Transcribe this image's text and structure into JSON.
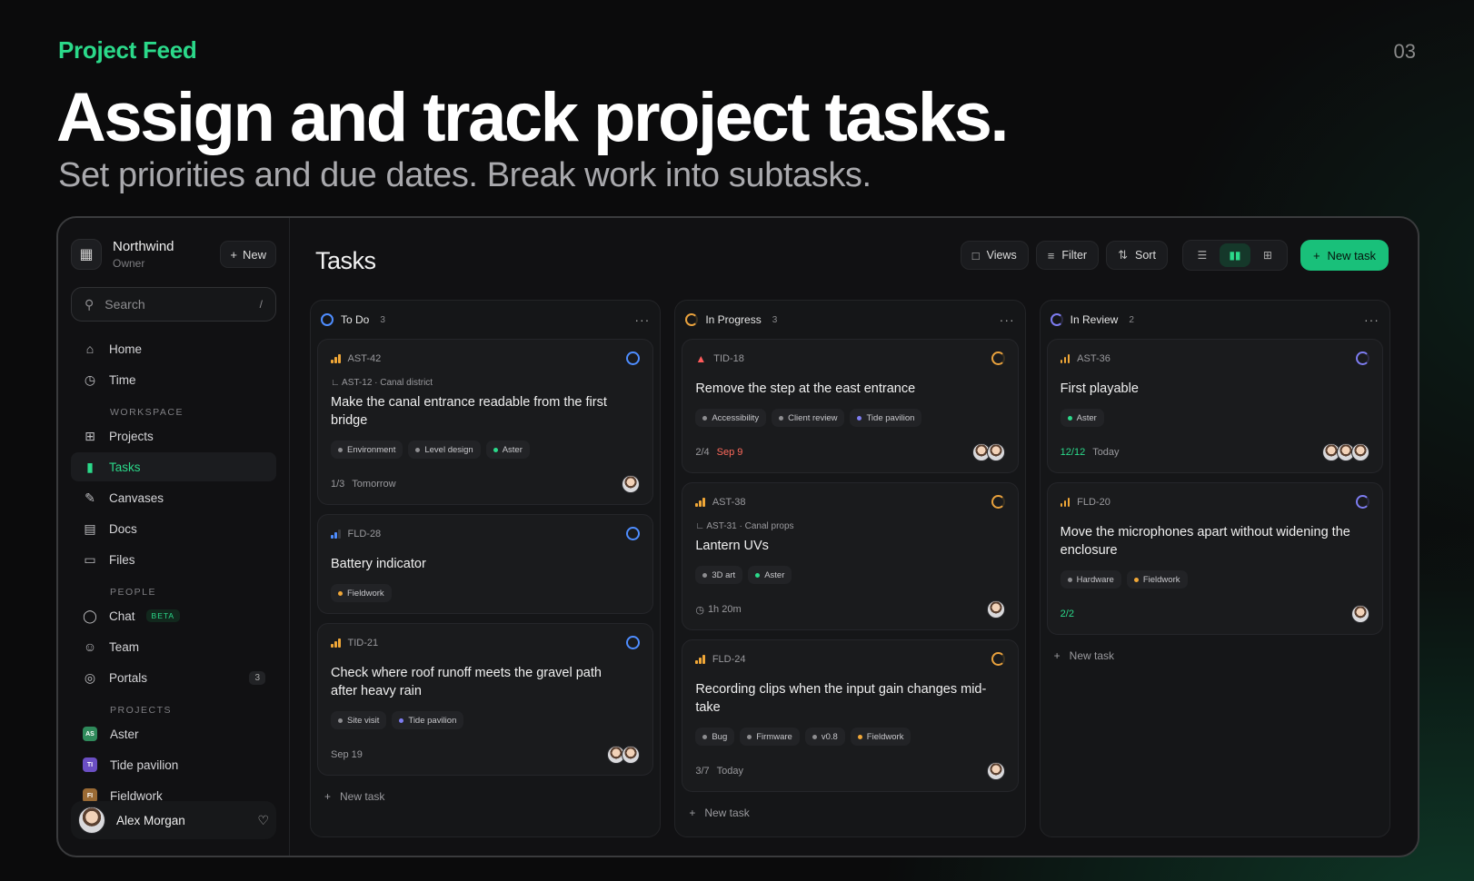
{
  "header": {
    "kicker": "Project Feed",
    "page_number": "03",
    "headline": "Assign and track project tasks.",
    "subhead": "Set priorities and due dates. Break work into subtasks."
  },
  "sidebar": {
    "workspace_name": "Northwind",
    "workspace_role": "Owner",
    "new_label": "New",
    "search_placeholder": "Search",
    "search_shortcut": "/",
    "nav": [
      {
        "label": "Home",
        "icon": "home-icon"
      },
      {
        "label": "Time",
        "icon": "clock-icon"
      }
    ],
    "workspace_section": "WORKSPACE",
    "workspace_items": [
      {
        "label": "Projects",
        "icon": "grid-icon"
      },
      {
        "label": "Tasks",
        "icon": "board-icon"
      },
      {
        "label": "Canvases",
        "icon": "brush-icon"
      },
      {
        "label": "Docs",
        "icon": "doc-icon"
      },
      {
        "label": "Files",
        "icon": "folder-icon"
      }
    ],
    "people_section": "PEOPLE",
    "chat_label": "Chat",
    "beta_label": "BETA",
    "team_label": "Team",
    "portals_label": "Portals",
    "portals_count": "3",
    "projects_section": "PROJECTS",
    "projects": [
      {
        "label": "Aster",
        "initials": "AS",
        "color": "#2f8a5b"
      },
      {
        "label": "Tide pavilion",
        "initials": "TI",
        "color": "#6b4fc4"
      },
      {
        "label": "Fieldwork",
        "initials": "FI",
        "color": "#9a6a34"
      }
    ],
    "user_name": "Alex Morgan"
  },
  "main": {
    "title": "Tasks",
    "views_label": "Views",
    "filter_label": "Filter",
    "sort_label": "Sort",
    "new_task_label": "New task"
  },
  "columns": [
    {
      "name": "To Do",
      "count": "3",
      "add_label": "New task",
      "cards": [
        {
          "id": "AST-42",
          "parent": "AST-12 · Canal district",
          "title": "Make the canal entrance readable from the first bridge",
          "tags": [
            "Environment",
            "Level design",
            "Aster"
          ],
          "progress": "1/3",
          "due": "Tomorrow"
        },
        {
          "id": "FLD-28",
          "title": "Battery indicator",
          "tags": [
            "Fieldwork"
          ]
        },
        {
          "id": "TID-21",
          "title": "Check where roof runoff meets the gravel path after heavy rain",
          "tags": [
            "Site visit",
            "Tide pavilion"
          ],
          "due": "Sep 19"
        }
      ]
    },
    {
      "name": "In Progress",
      "count": "3",
      "add_label": "New task",
      "cards": [
        {
          "id": "TID-18",
          "title": "Remove the step at the east entrance",
          "tags": [
            "Accessibility",
            "Client review",
            "Tide pavilion"
          ],
          "progress": "2/4",
          "due": "Sep 9"
        },
        {
          "id": "AST-38",
          "parent": "AST-31 · Canal props",
          "title": "Lantern UVs",
          "tags": [
            "3D art",
            "Aster"
          ],
          "time": "1h 20m"
        },
        {
          "id": "FLD-24",
          "title": "Recording clips when the input gain changes mid-take",
          "tags": [
            "Bug",
            "Firmware",
            "v0.8",
            "Fieldwork"
          ],
          "progress": "3/7",
          "due": "Today"
        }
      ]
    },
    {
      "name": "In Review",
      "count": "2",
      "add_label": "New task",
      "cards": [
        {
          "id": "AST-36",
          "title": "First playable",
          "tags": [
            "Aster"
          ],
          "progress": "12/12",
          "due": "Today"
        },
        {
          "id": "FLD-20",
          "title": "Move the microphones apart without widening the enclosure",
          "tags": [
            "Hardware",
            "Fieldwork"
          ],
          "progress": "2/2"
        }
      ]
    }
  ],
  "colors": {
    "accent": "#2bd98a",
    "todo": "#4e8dff",
    "progress": "#e8a13d",
    "review": "#7d7cf0",
    "urgent": "#ff5b5b"
  }
}
